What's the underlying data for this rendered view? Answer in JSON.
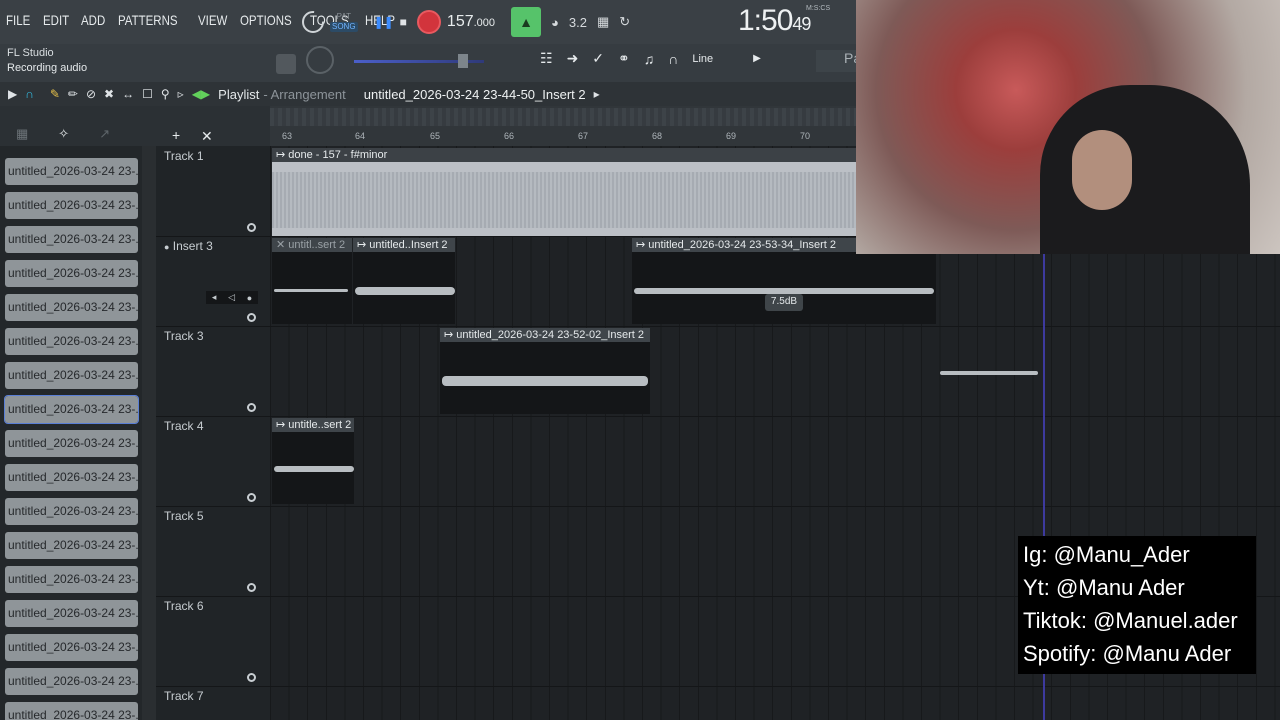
{
  "menu": [
    "FILE",
    "EDIT",
    "ADD",
    "PATTERNS",
    "VIEW",
    "OPTIONS",
    "TOOLS",
    "HELP"
  ],
  "transport": {
    "pat_label": "PAT",
    "song_label": "SONG",
    "tempo": "157",
    "tempo_fraction": ".000",
    "play_icon": "pause-icon",
    "stop_icon": "stop-icon",
    "record_icon": "record-icon",
    "beat_glyph": "3.2"
  },
  "clock": {
    "main": "1:50",
    "sub": "49",
    "unit": "M:S:CS"
  },
  "status": {
    "app_name": "FL Studio",
    "hint": "Recording audio"
  },
  "snap": {
    "label": "Line",
    "pa": "Pa"
  },
  "playlist": {
    "title": "Playlist",
    "subtitle": "- Arrangement",
    "file": "untitled_2026-03-24 23-44-50_Insert 2"
  },
  "ruler": {
    "bars": [
      "63",
      "64",
      "65",
      "66",
      "67",
      "68",
      "69",
      "70"
    ]
  },
  "browser": {
    "items": [
      "untitled_2026-03-24 23-...",
      "untitled_2026-03-24 23-...",
      "untitled_2026-03-24 23-...",
      "untitled_2026-03-24 23-...",
      "untitled_2026-03-24 23-...",
      "untitled_2026-03-24 23-...",
      "untitled_2026-03-24 23-...",
      "untitled_2026-03-24 23-...",
      "untitled_2026-03-24 23-...",
      "untitled_2026-03-24 23-...",
      "untitled_2026-03-24 23-...",
      "untitled_2026-03-24 23-...",
      "untitled_2026-03-24 23-...",
      "untitled_2026-03-24 23-...",
      "untitled_2026-03-24 23-...",
      "untitled_2026-03-24 23-...",
      "untitled_2026-03-24 23-..."
    ],
    "selected_index": 7
  },
  "tracks": [
    "Track 1",
    "Insert 3",
    "Track 3",
    "Track 4",
    "Track 5",
    "Track 6",
    "Track 7"
  ],
  "clips": {
    "done": "done - 157 - f#minor",
    "ins3_a": "untitl..sert 2",
    "ins3_b": "untitled..Insert 2",
    "ins3_c": "untitled_2026-03-24 23-53-34_Insert 2",
    "track3": "untitled_2026-03-24 23-52-02_Insert 2",
    "track4": "untitle..sert 2",
    "volume_tip": "7.5dB"
  },
  "social": [
    "Ig: @Manu_Ader",
    "Yt: @Manu Ader",
    "Tiktok: @Manuel.ader",
    "Spotify: @Manu Ader"
  ]
}
